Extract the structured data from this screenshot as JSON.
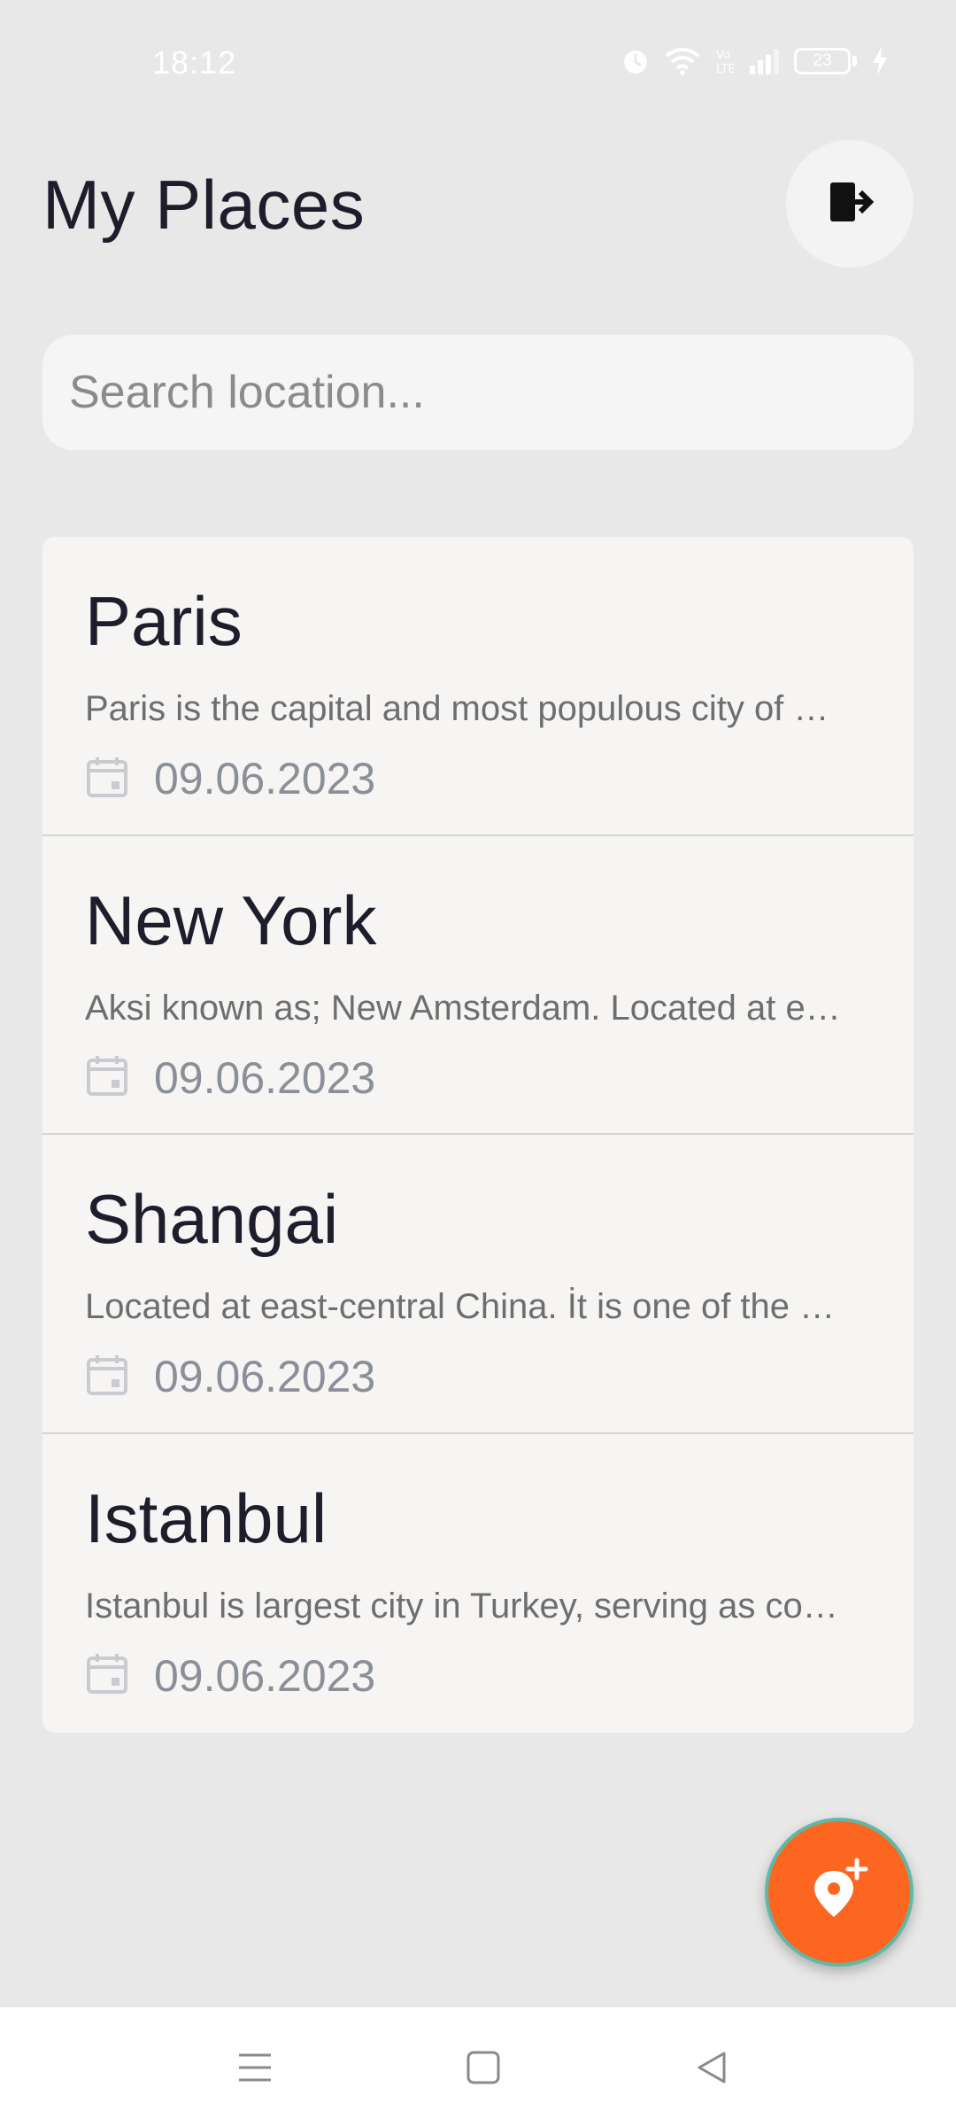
{
  "status_bar": {
    "time": "18:12",
    "battery": "23",
    "icons": [
      "alarm-icon",
      "wifi-icon",
      "volte-icon",
      "signal-icon",
      "battery-icon",
      "charging-icon"
    ]
  },
  "header": {
    "title": "My Places",
    "logout_icon": "logout-icon"
  },
  "search": {
    "placeholder": "Search location...",
    "value": ""
  },
  "places": [
    {
      "name": "Paris",
      "description": "Paris is the capital and most populous city of …",
      "date": "09.06.2023"
    },
    {
      "name": "New York",
      "description": "Aksi known as; New Amsterdam. Located at e…",
      "date": "09.06.2023"
    },
    {
      "name": "Shangai",
      "description": "Located at east-central China. İt is one of the …",
      "date": "09.06.2023"
    },
    {
      "name": "Istanbul",
      "description": "Istanbul is largest city in Turkey, serving as co…",
      "date": "09.06.2023"
    }
  ],
  "fab": {
    "icon": "add-location-icon"
  },
  "colors": {
    "background": "#e8e8e8",
    "card": "#f6f5f4",
    "accent": "#fc6621",
    "fab_border": "#5fb8a6",
    "title_text": "#1d1d2b",
    "date_text": "#8a8f98"
  },
  "nav_bar": {
    "icons": [
      "menu-icon",
      "home-icon",
      "back-icon"
    ]
  }
}
